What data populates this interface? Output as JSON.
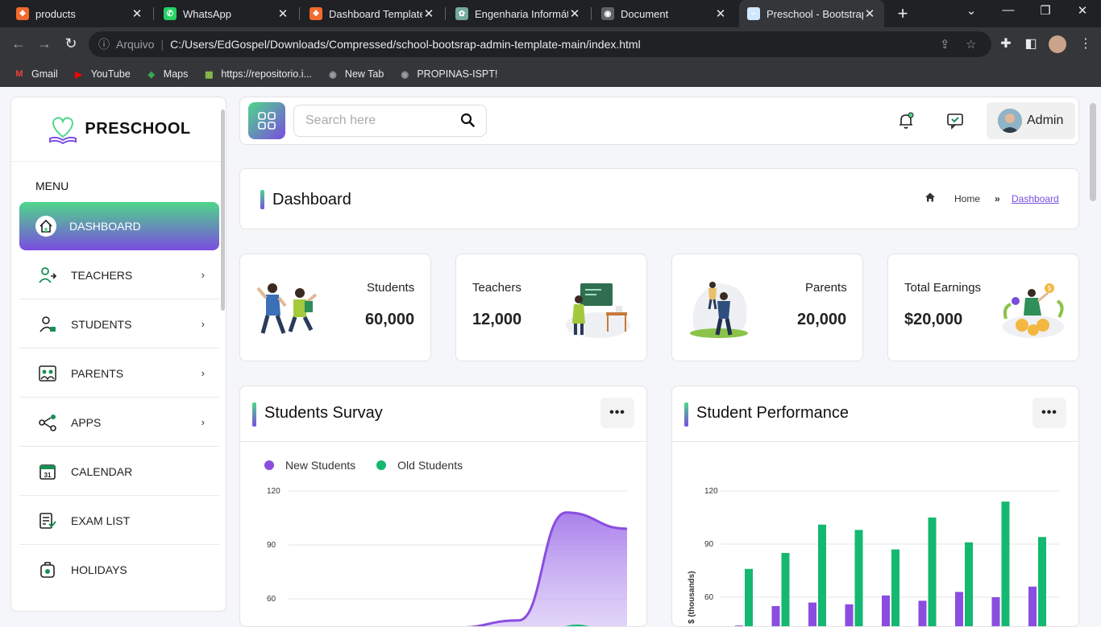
{
  "browser": {
    "tabs": [
      {
        "title": "products",
        "favicon": "#f26a2e",
        "glyph": "❖"
      },
      {
        "title": "WhatsApp",
        "favicon": "#25d366",
        "glyph": "✆"
      },
      {
        "title": "Dashboard Template -",
        "favicon": "#f26a2e",
        "glyph": "❖"
      },
      {
        "title": "Engenharia Informátic",
        "favicon": "#74aa9c",
        "glyph": "✿"
      },
      {
        "title": "Document",
        "favicon": "#5f6368",
        "glyph": "◉"
      },
      {
        "title": "Preschool - Bootstrap",
        "favicon": "#cfe8ff",
        "glyph": "~"
      }
    ],
    "address": {
      "prefix": "Arquivo",
      "url": "C:/Users/EdGospel/Downloads/Compressed/school-bootsrap-admin-template-main/index.html"
    },
    "bookmarks": [
      {
        "label": "Gmail",
        "color": "#ea4335",
        "glyph": "M"
      },
      {
        "label": "YouTube",
        "color": "#ff0000",
        "glyph": "▶"
      },
      {
        "label": "Maps",
        "color": "#34a853",
        "glyph": "◆"
      },
      {
        "label": "https://repositorio.i...",
        "color": "#8bc34a",
        "glyph": "▦"
      },
      {
        "label": "New Tab",
        "color": "#9aa0a6",
        "glyph": "◉"
      },
      {
        "label": "PROPINAS-ISPT!",
        "color": "#9aa0a6",
        "glyph": "◉"
      }
    ]
  },
  "sidebar": {
    "brand": "PRESCHOOL",
    "menu_title": "MENU",
    "items": [
      {
        "label": "DASHBOARD",
        "icon": "home-icon",
        "active": true
      },
      {
        "label": "TEACHERS",
        "icon": "teacher-icon",
        "chevron": "›"
      },
      {
        "label": "STUDENTS",
        "icon": "student-icon",
        "chevron": "›"
      },
      {
        "label": "PARENTS",
        "icon": "parents-icon",
        "chevron": "›"
      },
      {
        "label": "APPS",
        "icon": "share-icon",
        "chevron": "›"
      },
      {
        "label": "CALENDAR",
        "icon": "calendar-icon"
      },
      {
        "label": "EXAM LIST",
        "icon": "exam-icon"
      },
      {
        "label": "HOLIDAYS",
        "icon": "holiday-icon"
      }
    ]
  },
  "topbar": {
    "search_placeholder": "Search here",
    "admin_label": "Admin"
  },
  "page_header": {
    "title": "Dashboard",
    "breadcrumb_home": "Home",
    "breadcrumb_current": "Dashboard"
  },
  "stats": [
    {
      "label": "Students",
      "value": "60,000"
    },
    {
      "label": "Teachers",
      "value": "12,000"
    },
    {
      "label": "Parents",
      "value": "20,000"
    },
    {
      "label": "Total Earnings",
      "value": "$20,000"
    }
  ],
  "colors": {
    "accent_green": "#4ed68a",
    "accent_purple": "#7a4de0",
    "series_purple": "#8a4de0",
    "series_green": "#14b871"
  },
  "panels": {
    "survey_title": "Students Survay",
    "performance_title": "Student Performance",
    "menu_glyph": "•••"
  },
  "chart_data": [
    {
      "type": "area",
      "title": "Students Survay",
      "series": [
        {
          "name": "New Students",
          "color": "#8a4de0"
        },
        {
          "name": "Old Students",
          "color": "#14b871"
        }
      ],
      "y_ticks": [
        "120",
        "90",
        "60"
      ],
      "ylim_visible": [
        60,
        120
      ],
      "new_students_visible_curve": [
        [
          0,
          40
        ],
        [
          0.5,
          44
        ],
        [
          0.68,
          48
        ],
        [
          0.82,
          108
        ],
        [
          1.0,
          99
        ]
      ]
    },
    {
      "type": "bar",
      "title": "Student Performance",
      "ylabel": "$ (thousands)",
      "y_ticks": [
        "120",
        "90",
        "60"
      ],
      "ylim_visible": [
        55,
        120
      ],
      "series": [
        {
          "color": "#8a4de0",
          "values": [
            44,
            55,
            57,
            56,
            61,
            58,
            63,
            60,
            66
          ]
        },
        {
          "color": "#14b871",
          "values": [
            76,
            85,
            101,
            98,
            87,
            105,
            91,
            114,
            94
          ]
        }
      ]
    }
  ]
}
